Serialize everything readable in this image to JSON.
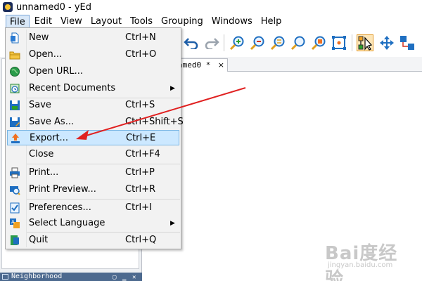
{
  "window": {
    "title": "unnamed0 - yEd"
  },
  "menubar": {
    "items": [
      "File",
      "Edit",
      "View",
      "Layout",
      "Tools",
      "Grouping",
      "Windows",
      "Help"
    ],
    "active": "File"
  },
  "toolbar": {
    "icons": [
      "undo-icon",
      "redo-icon",
      "zoom-in-icon",
      "zoom-out-icon",
      "zoom-100-icon",
      "zoom-area-icon",
      "zoom-fit-icon",
      "fit-content-icon",
      "edit-mode-icon",
      "move-view-icon",
      "grouping-icon"
    ],
    "pressed": "edit-mode-icon"
  },
  "document": {
    "tab_label": "amed0 *",
    "tab_close": "×"
  },
  "file_menu": {
    "items": [
      {
        "label": "New",
        "shortcut": "Ctrl+N",
        "icon": "new-document-icon"
      },
      {
        "label": "Open...",
        "shortcut": "Ctrl+O",
        "icon": "open-folder-icon"
      },
      {
        "label": "Open URL...",
        "shortcut": "",
        "icon": "globe-icon"
      },
      {
        "label": "Recent Documents",
        "shortcut": "",
        "icon": "recent-documents-icon",
        "submenu": "▶"
      },
      {
        "label": "Save",
        "shortcut": "Ctrl+S",
        "icon": "save-icon"
      },
      {
        "label": "Save As...",
        "shortcut": "Ctrl+Shift+S",
        "icon": "save-as-icon"
      },
      {
        "label": "Export...",
        "shortcut": "Ctrl+E",
        "icon": "export-icon"
      },
      {
        "label": "Close",
        "shortcut": "Ctrl+F4",
        "icon": ""
      },
      {
        "label": "Print...",
        "shortcut": "Ctrl+P",
        "icon": "print-icon"
      },
      {
        "label": "Print Preview...",
        "shortcut": "Ctrl+R",
        "icon": "print-preview-icon"
      },
      {
        "label": "Preferences...",
        "shortcut": "Ctrl+I",
        "icon": "preferences-icon"
      },
      {
        "label": "Select Language",
        "shortcut": "",
        "icon": "language-icon",
        "submenu": "▶"
      },
      {
        "label": "Quit",
        "shortcut": "Ctrl+Q",
        "icon": "quit-icon"
      }
    ],
    "highlighted": "Export..."
  },
  "panels": {
    "neighborhood_title": "Neighborhood"
  },
  "colors": {
    "menu_highlight": "#cce8ff",
    "menu_highlight_border": "#7ab5e3",
    "annotation_arrow": "#e02020",
    "panel_header": "#4d6a8f"
  },
  "watermark": {
    "brand": "Bai度经验",
    "url": "jingyan.baidu.com"
  }
}
